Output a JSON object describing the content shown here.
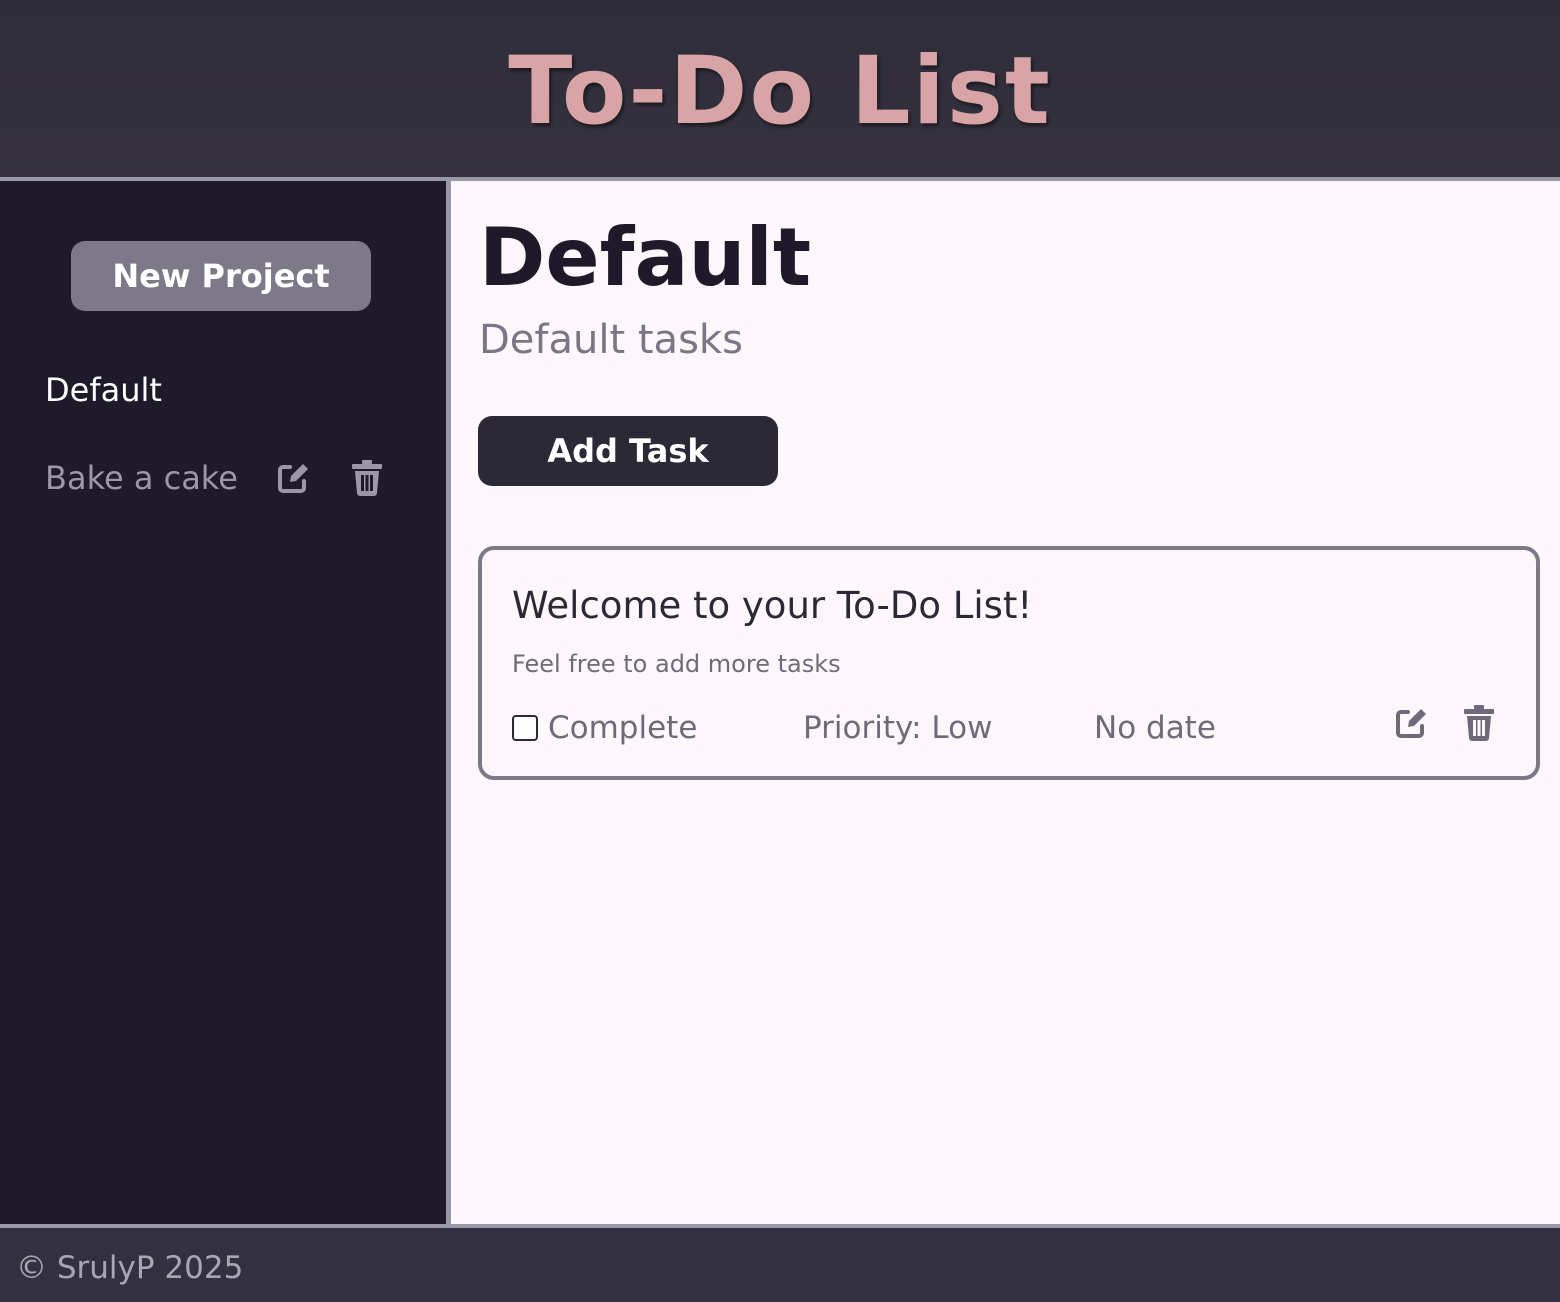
{
  "header": {
    "title": "To-Do List"
  },
  "sidebar": {
    "new_project_label": "New Project",
    "projects": [
      {
        "label": "Default"
      },
      {
        "label": "Bake a cake",
        "edit_icon": "edit-icon",
        "delete_icon": "trash-icon"
      }
    ]
  },
  "main": {
    "project_title": "Default",
    "project_description": "Default tasks",
    "add_task_label": "Add Task",
    "tasks": [
      {
        "title": "Welcome to your To-Do List!",
        "description": "Feel free to add more tasks",
        "complete_label": "Complete",
        "completed": false,
        "priority": "Priority: Low",
        "due": "No date",
        "edit_icon": "edit-icon",
        "delete_icon": "trash-icon"
      }
    ]
  },
  "footer": {
    "copyright": "© SrulyP 2025"
  },
  "colors": {
    "header_bg": "#33303f",
    "title": "#d8a4a6",
    "sidebar_bg": "#1e1a2a",
    "main_bg": "#fdf7fc",
    "accent_button": "#2c2937",
    "secondary_button": "#7e7989",
    "border": "#9a97a6"
  }
}
